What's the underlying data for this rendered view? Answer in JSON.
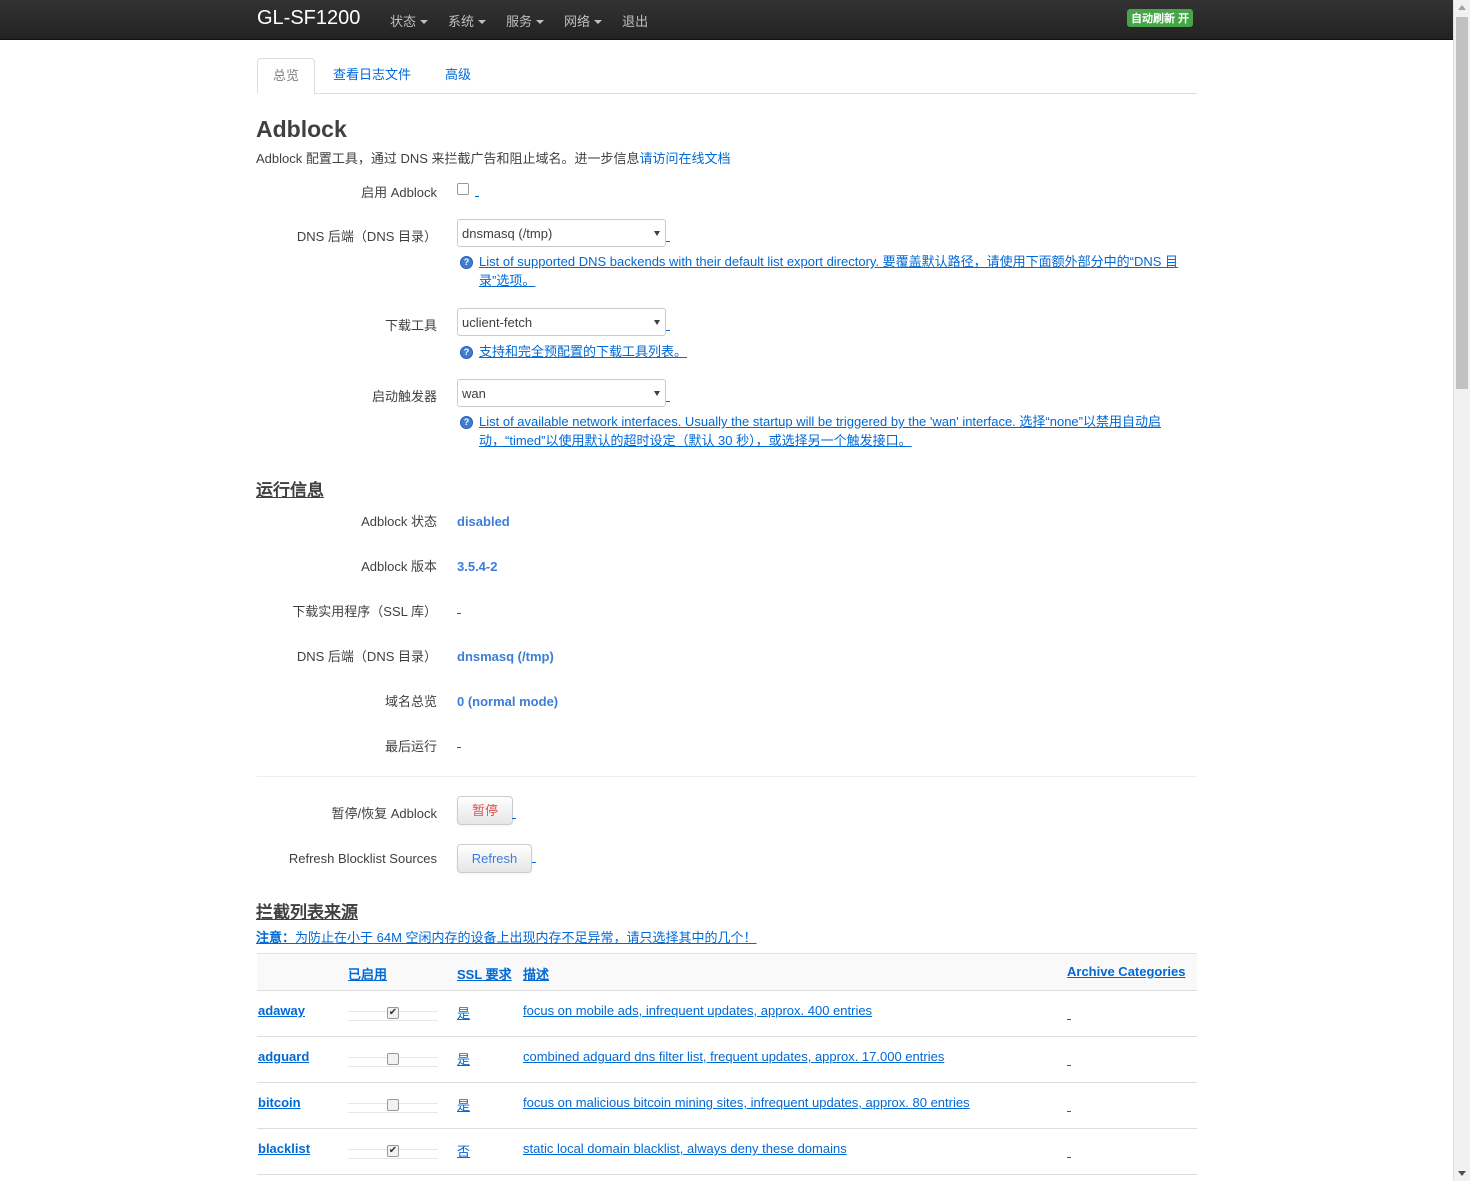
{
  "navbar": {
    "brand": "GL-SF1200",
    "menu": [
      {
        "label": "状态",
        "dropdown": true
      },
      {
        "label": "系统",
        "dropdown": true
      },
      {
        "label": "服务",
        "dropdown": true
      },
      {
        "label": "网络",
        "dropdown": true
      },
      {
        "label": "退出",
        "dropdown": false
      }
    ],
    "autorefresh": "自动刷新 开"
  },
  "tabs": [
    "总览",
    "查看日志文件",
    "高级"
  ],
  "page": {
    "title": "Adblock",
    "description": "Adblock 配置工具，通过 DNS 来拦截广告和阻止域名。进一步信息",
    "doc_link": "请访问在线文档"
  },
  "settings": {
    "enable_label": "启用 Adblock",
    "enable_checked": false,
    "dns_label": "DNS 后端（DNS 目录）",
    "dns_value": "dnsmasq (/tmp)",
    "dns_help": "List of supported DNS backends with their default list export directory. 要覆盖默认路径，请使用下面额外部分中的“DNS 目录”选项。",
    "fetch_label": "下载工具",
    "fetch_value": "uclient-fetch",
    "fetch_help": "支持和完全预配置的下载工具列表。",
    "trigger_label": "启动触发器",
    "trigger_value": "wan",
    "trigger_help": "List of available network interfaces. Usually the startup will be triggered by the 'wan' interface. 选择“none”以禁用自动启动，“timed”以使用默认的超时设定（默认 30 秒），或选择另一个触发接口。"
  },
  "runtime": {
    "heading": "运行信息",
    "rows": [
      {
        "label": "Adblock 状态",
        "value": "disabled"
      },
      {
        "label": "Adblock 版本",
        "value": "3.5.4-2"
      },
      {
        "label": "下载实用程序（SSL 库）",
        "value": ""
      },
      {
        "label": "DNS 后端（DNS 目录）",
        "value": "dnsmasq (/tmp)"
      },
      {
        "label": "域名总览",
        "value": "0 (normal mode)"
      },
      {
        "label": "最后运行",
        "value": ""
      }
    ]
  },
  "actions": {
    "suspend_label": "暂停/恢复 Adblock",
    "suspend_button": "暂停",
    "refresh_label": "Refresh Blocklist Sources",
    "refresh_button": "Refresh"
  },
  "blocklist": {
    "heading": "拦截列表来源",
    "note_bold": "注意：",
    "note": "为防止在小于 64M 空闲内存的设备上出现内存不足异常，请只选择其中的几个！",
    "columns": {
      "enabled": "已启用",
      "ssl": "SSL 要求",
      "desc": "描述",
      "archive": "Archive Categories"
    },
    "rows": [
      {
        "name": "adaway",
        "enabled": true,
        "ssl": "是",
        "desc": "focus on mobile ads, infrequent updates, approx. 400 entries"
      },
      {
        "name": "adguard",
        "enabled": false,
        "ssl": "是",
        "desc": "combined adguard dns filter list, frequent updates, approx. 17.000 entries"
      },
      {
        "name": "bitcoin",
        "enabled": false,
        "ssl": "是",
        "desc": "focus on malicious bitcoin mining sites, infrequent updates, approx. 80 entries"
      },
      {
        "name": "blacklist",
        "enabled": true,
        "ssl": "否",
        "desc": "static local domain blacklist, always deny these domains"
      }
    ]
  },
  "colors": {
    "link": "#0069d6",
    "value": "#3b7dd8",
    "navbar": "#222222",
    "autorefresh": "#46a546",
    "suspend_text": "#d9534f"
  }
}
